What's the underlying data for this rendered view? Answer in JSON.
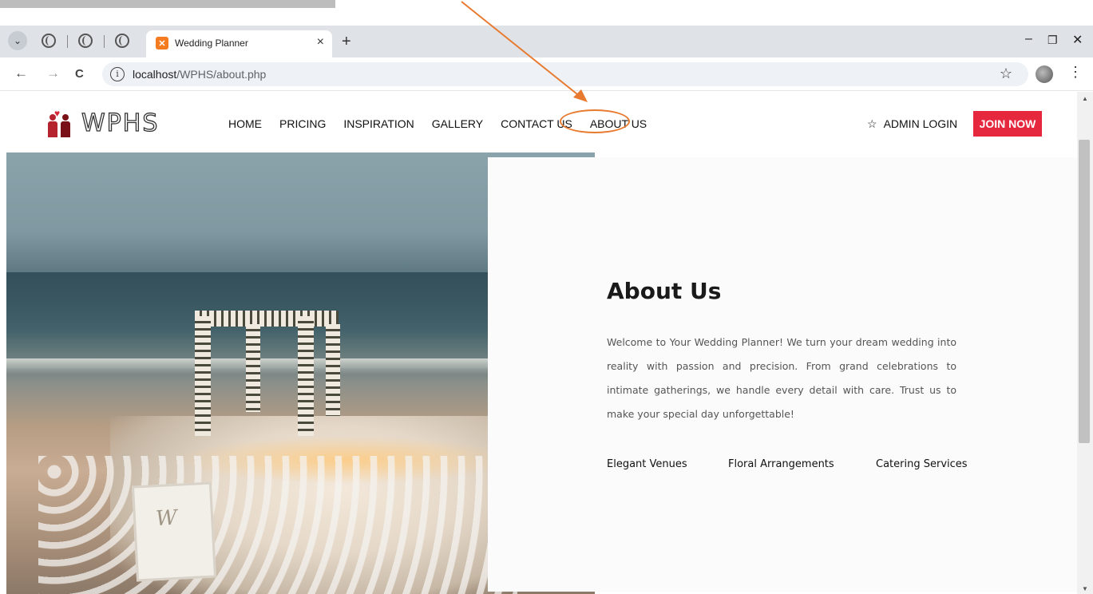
{
  "browser": {
    "tab_title": "Wedding Planner",
    "url_host": "localhost",
    "url_path": "/WPHS/about.php",
    "icons": {
      "dropdown": "chevron-down-icon",
      "recent_tab": "globe-icon",
      "close_tab": "close-icon",
      "new_tab": "plus-icon",
      "back": "arrow-left-icon",
      "forward": "arrow-right-icon",
      "reload": "reload-icon",
      "site_info": "info-icon",
      "bookmark": "star-icon",
      "profile": "avatar",
      "menu": "kebab-icon",
      "minimize": "minimize-icon",
      "restore": "restore-icon",
      "close_window": "close-icon"
    },
    "glyphs": {
      "dropdown": "⌄",
      "close_tab": "×",
      "new_tab": "+",
      "back": "←",
      "forward": "→",
      "reload": "C",
      "site_info": "i",
      "bookmark": "☆",
      "menu": "⋮",
      "minimize": "–",
      "restore": "❐",
      "close_window": "✕"
    }
  },
  "site": {
    "logo_text": "WPHS",
    "nav": [
      {
        "label": "HOME"
      },
      {
        "label": "PRICING"
      },
      {
        "label": "INSPIRATION"
      },
      {
        "label": "GALLERY"
      },
      {
        "label": "CONTACT US"
      },
      {
        "label": "ABOUT US",
        "highlighted": true
      }
    ],
    "admin_login": {
      "icon": "star-icon",
      "glyph": "☆",
      "label": "ADMIN LOGIN"
    },
    "join_button": "JOIN NOW",
    "colors": {
      "accent": "#e5283e",
      "logo_primary": "#b5232e",
      "annotation": "#e87a30"
    }
  },
  "about": {
    "title": "About Us",
    "body": "Welcome to Your Wedding Planner! We turn your dream wedding into reality with passion and precision. From grand celebrations to intimate gatherings, we handle every detail with care. Trust us to make your special day unforgettable!",
    "features": [
      {
        "label": "Elegant Venues"
      },
      {
        "label": "Floral Arrangements"
      },
      {
        "label": "Catering Services"
      }
    ]
  },
  "scrollbar": {
    "up": "▲",
    "down": "▼"
  }
}
